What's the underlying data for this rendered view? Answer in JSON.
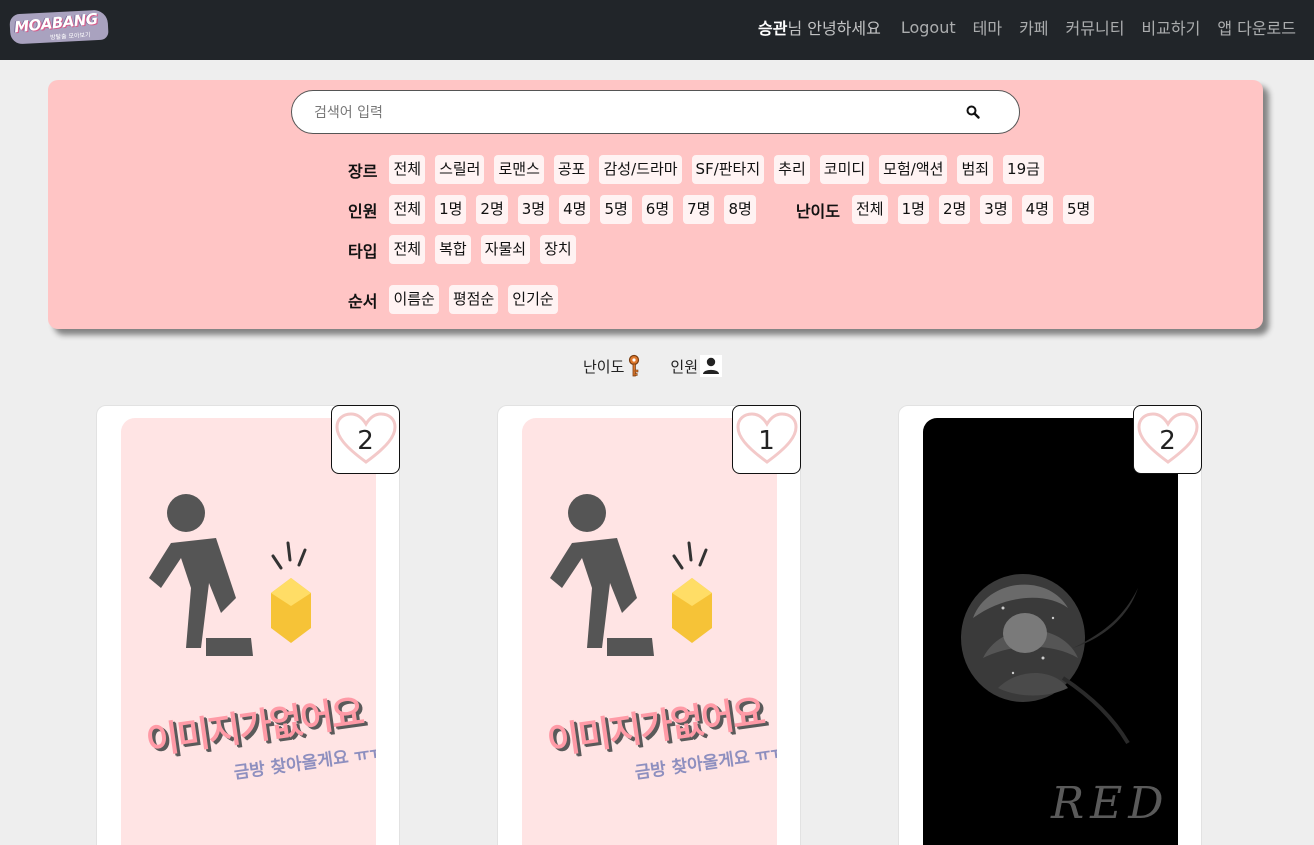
{
  "navbar": {
    "logo_text": "MOABANG",
    "logo_tagline": "방탈출 모아보기",
    "user_name": "승관",
    "greeting_suffix": "님 안녕하세요",
    "links": [
      "Logout",
      "테마",
      "카페",
      "커뮤니티",
      "비교하기",
      "앱 다운로드"
    ]
  },
  "search": {
    "placeholder": "검색어 입력",
    "icon": "search-icon"
  },
  "filters": {
    "genre": {
      "label": "장르",
      "options": [
        "전체",
        "스릴러",
        "로맨스",
        "공포",
        "감성/드라마",
        "SF/판타지",
        "추리",
        "코미디",
        "모험/액션",
        "범죄",
        "19금"
      ]
    },
    "people": {
      "label": "인원",
      "options": [
        "전체",
        "1명",
        "2명",
        "3명",
        "4명",
        "5명",
        "6명",
        "7명",
        "8명"
      ]
    },
    "difficulty": {
      "label": "난이도",
      "options": [
        "전체",
        "1명",
        "2명",
        "3명",
        "4명",
        "5명"
      ]
    },
    "type": {
      "label": "타입",
      "options": [
        "전체",
        "복합",
        "자물쇠",
        "장치"
      ]
    },
    "order": {
      "label": "순서",
      "options": [
        "이름순",
        "평점순",
        "인기순"
      ]
    }
  },
  "legend": {
    "difficulty_label": "난이도",
    "difficulty_icon": "key-icon",
    "people_label": "인원",
    "people_icon": "person-icon"
  },
  "cards": [
    {
      "likes": "2",
      "poster": "no-image",
      "poster_title": "이미지가없어요",
      "poster_sub": "금방 찾아올게요 ㅠㅠ"
    },
    {
      "likes": "1",
      "poster": "no-image",
      "poster_title": "이미지가없어요",
      "poster_sub": "금방 찾아올게요 ㅠㅠ"
    },
    {
      "likes": "2",
      "poster": "black-rose",
      "poster_title": "RED"
    }
  ],
  "colors": {
    "navbar": "#212529",
    "panel": "#ffc5c5",
    "chip": "#fff3f3",
    "heart": "#f3c9c9"
  }
}
